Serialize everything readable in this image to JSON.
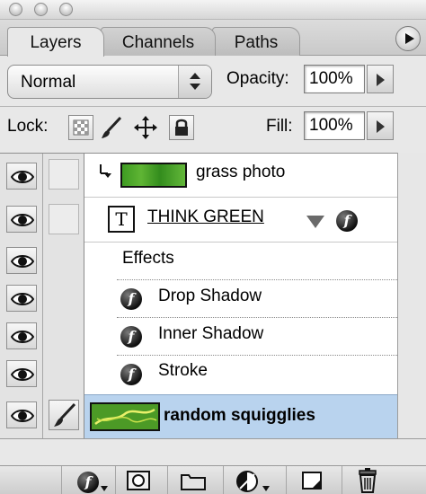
{
  "tabs": [
    {
      "label": "Layers",
      "active": true
    },
    {
      "label": "Channels",
      "active": false
    },
    {
      "label": "Paths",
      "active": false
    }
  ],
  "blend": {
    "mode": "Normal"
  },
  "opacity": {
    "label": "Opacity:",
    "value": "100%"
  },
  "lock": {
    "label": "Lock:"
  },
  "fill": {
    "label": "Fill:",
    "value": "100%"
  },
  "layers": {
    "grass": {
      "name": "grass photo",
      "thumb_color": "#3e9b22"
    },
    "text": {
      "name": "THINK GREEN",
      "type_glyph": "T"
    },
    "effects": {
      "header": "Effects",
      "items": [
        "Drop Shadow",
        "Inner Shadow",
        "Stroke"
      ]
    },
    "squiggles": {
      "name": "random squigglies",
      "thumb_color": "#4c9a26"
    }
  },
  "colors": {
    "selection": "#b9d3ee",
    "panel": "#e8e8e8"
  },
  "icons": [
    "eye-icon",
    "brush-icon",
    "move-icon",
    "lock-icon",
    "fx-icon",
    "mask-icon",
    "folder-icon",
    "adjustment-icon",
    "new-layer-icon",
    "trash-icon"
  ]
}
